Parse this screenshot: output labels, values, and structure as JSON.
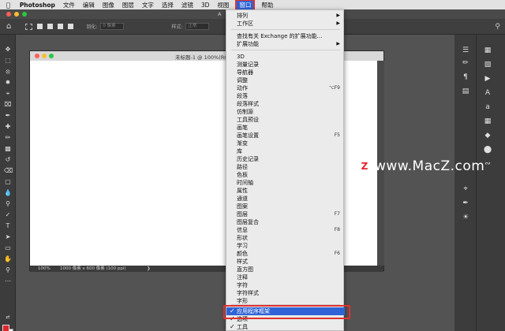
{
  "menubar": {
    "apple_icon": "apple-icon",
    "app_name": "Photoshop",
    "items": [
      "文件",
      "编辑",
      "图像",
      "图层",
      "文字",
      "选择",
      "滤镜",
      "3D",
      "视图",
      "窗口",
      "帮助"
    ],
    "active_item": "窗口"
  },
  "tabstrip": {
    "title": "A"
  },
  "options_bar": {
    "feather_label": "羽化:",
    "feather_value": "0 像素",
    "style_label": "样式:",
    "style_value": "正常"
  },
  "document": {
    "title": "未标题-1 @ 100%(RGB",
    "zoom": "100%",
    "size": "1000 像素 x 600 像素 (100 ppi)"
  },
  "window_menu": {
    "items": [
      {
        "label": "排列",
        "shortcut": "",
        "submenu": true
      },
      {
        "label": "工作区",
        "shortcut": "",
        "submenu": true
      },
      {
        "label": "查找有关 Exchange 的扩展功能...",
        "shortcut": "",
        "submenu": false
      },
      {
        "label": "扩展功能",
        "shortcut": "",
        "submenu": true
      },
      {
        "label": "3D",
        "shortcut": ""
      },
      {
        "label": "测量记录",
        "shortcut": ""
      },
      {
        "label": "导航器",
        "shortcut": ""
      },
      {
        "label": "调整",
        "shortcut": ""
      },
      {
        "label": "动作",
        "shortcut": "⌥F9"
      },
      {
        "label": "段落",
        "shortcut": ""
      },
      {
        "label": "段落样式",
        "shortcut": ""
      },
      {
        "label": "仿制源",
        "shortcut": ""
      },
      {
        "label": "工具预设",
        "shortcut": ""
      },
      {
        "label": "画笔",
        "shortcut": ""
      },
      {
        "label": "画笔设置",
        "shortcut": "F5"
      },
      {
        "label": "渐变",
        "shortcut": ""
      },
      {
        "label": "库",
        "shortcut": ""
      },
      {
        "label": "历史记录",
        "shortcut": ""
      },
      {
        "label": "路径",
        "shortcut": ""
      },
      {
        "label": "色板",
        "shortcut": ""
      },
      {
        "label": "时间轴",
        "shortcut": ""
      },
      {
        "label": "属性",
        "shortcut": ""
      },
      {
        "label": "通道",
        "shortcut": ""
      },
      {
        "label": "图案",
        "shortcut": ""
      },
      {
        "label": "图层",
        "shortcut": "F7"
      },
      {
        "label": "图层复合",
        "shortcut": ""
      },
      {
        "label": "信息",
        "shortcut": "F8"
      },
      {
        "label": "形状",
        "shortcut": ""
      },
      {
        "label": "学习",
        "shortcut": ""
      },
      {
        "label": "颜色",
        "shortcut": "F6"
      },
      {
        "label": "样式",
        "shortcut": ""
      },
      {
        "label": "直方图",
        "shortcut": ""
      },
      {
        "label": "注释",
        "shortcut": ""
      },
      {
        "label": "字符",
        "shortcut": ""
      },
      {
        "label": "字符样式",
        "shortcut": ""
      },
      {
        "label": "字形",
        "shortcut": ""
      },
      {
        "label": "应用程序框架",
        "shortcut": "",
        "checked": true,
        "highlighted": true
      },
      {
        "label": "选项",
        "shortcut": "",
        "checked": true
      },
      {
        "label": "工具",
        "shortcut": "",
        "checked": true
      }
    ]
  },
  "watermark": {
    "logo": "Z",
    "text": "www.MacZ.com"
  },
  "colors": {
    "accent": "#2f63d6",
    "highlight_box": "#e0312f",
    "foreground": "#e3242b",
    "background": "#ffffff"
  }
}
